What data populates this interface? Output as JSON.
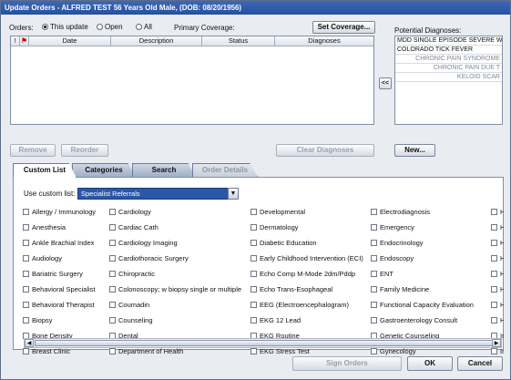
{
  "window": {
    "title": "Update Orders - ALFRED TEST 56 Years Old Male, (DOB: 08/20/1956)"
  },
  "orders": {
    "label": "Orders:",
    "options": [
      {
        "label": "This update",
        "selected": true
      },
      {
        "label": "Open",
        "selected": false
      },
      {
        "label": "All",
        "selected": false
      }
    ],
    "primary_coverage_label": "Primary Coverage:",
    "set_coverage_button": "Set Coverage..."
  },
  "grid": {
    "columns": [
      "!",
      "⚑",
      "Date",
      "Description",
      "Status",
      "Diagnoses"
    ]
  },
  "potential_diagnoses": {
    "label": "Potential Diagnoses:",
    "items": [
      {
        "text": "MDD SINGLE EPISODE SEVERE W",
        "active": true
      },
      {
        "text": "COLORADO TICK FEVER",
        "active": true
      },
      {
        "text": "CHRONIC PAIN SYNDROME",
        "active": false
      },
      {
        "text": "CHRONIC PAIN DUE T",
        "active": false
      },
      {
        "text": "KELOID SCAR",
        "active": false
      }
    ],
    "move_button": "<<",
    "new_button": "New..."
  },
  "actions": {
    "remove": "Remove",
    "reorder": "Reorder",
    "clear_diagnoses": "Clear Diagnoses"
  },
  "tabs": [
    {
      "label": "Custom List",
      "active": true,
      "enabled": true
    },
    {
      "label": "Categories",
      "active": false,
      "enabled": true
    },
    {
      "label": "Search",
      "active": false,
      "enabled": true
    },
    {
      "label": "Order Details",
      "active": false,
      "enabled": false
    }
  ],
  "custom_list": {
    "label": "Use custom list:",
    "selected": "Specialist Referrals",
    "columns": [
      [
        "Allergy / Immunology",
        "Anesthesia",
        "Ankle Brachial Index",
        "Audiology",
        "Bariatric Surgery",
        "Behavioral Specialist",
        "Behavioral Therapist",
        "Biopsy",
        "Bone Density",
        "Breast Clinic"
      ],
      [
        "Cardiology",
        "Cardiac Cath",
        "Cardiology Imaging",
        "Cardiothoracic Surgery",
        "Chiropractic",
        "Colonoscopy; w biopsy single or multiple",
        "Coumadin",
        "Counseling",
        "Dental",
        "Department of Health"
      ],
      [
        "Developmental",
        "Dermatology",
        "Diabetic Education",
        "Early Childhood Intervention (ECI)",
        "Echo Comp M-Mode 2dm/Pddp",
        "Echo Trans-Esophageal",
        "EEG (Electroencephalogram)",
        "EKG 12 Lead",
        "EKG Routine",
        "EKG Stress Test"
      ],
      [
        "Electrodiagnosis",
        "Emergency",
        "Endocrinology",
        "Endoscopy",
        "ENT",
        "Family Medicine",
        "Functional Capacity Evaluation",
        "Gastroenterology Consult",
        "Genetic Counseling",
        "Gynecology"
      ],
      [
        "He",
        "He",
        "He",
        "HI",
        "Ho",
        "Ho",
        "Ho",
        "Ho",
        "Int",
        "Int"
      ]
    ]
  },
  "footer": {
    "sign_orders": "Sign Orders",
    "ok": "OK",
    "cancel": "Cancel"
  }
}
